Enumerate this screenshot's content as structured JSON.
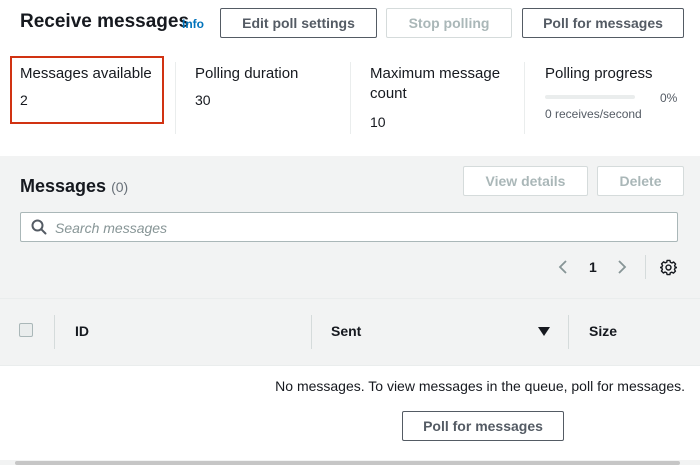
{
  "header": {
    "title": "Receive messages",
    "info_label": "Info",
    "edit_button": "Edit poll settings",
    "stop_button": "Stop polling",
    "poll_button": "Poll for messages"
  },
  "stats": {
    "messages_available": {
      "label": "Messages available",
      "value": "2"
    },
    "polling_duration": {
      "label": "Polling duration",
      "value": "30"
    },
    "max_count": {
      "label": "Maximum message count",
      "value": "10"
    },
    "polling_progress": {
      "label": "Polling progress",
      "percent_text": "0%",
      "rate": "0 receives/second",
      "fraction": 0
    }
  },
  "messages": {
    "title": "Messages",
    "count": "(0)",
    "view_details_button": "View details",
    "delete_button": "Delete",
    "search_placeholder": "Search messages",
    "page": "1",
    "columns": [
      "ID",
      "Sent",
      "Size"
    ],
    "empty_text": "No messages. To view messages in the queue, poll for messages.",
    "empty_poll_button": "Poll for messages"
  },
  "colors": {
    "accent": "#0073bb",
    "highlight": "#d13212"
  },
  "icons": [
    "search-icon",
    "chevron-left-icon",
    "chevron-right-icon",
    "gear-icon",
    "sort-down-icon"
  ]
}
